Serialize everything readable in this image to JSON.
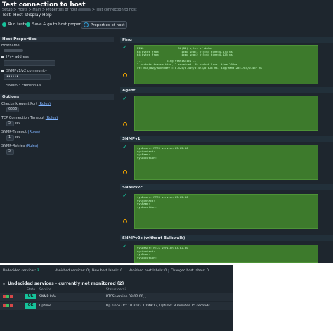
{
  "window": {
    "title": "Test connection to host",
    "breadcrumb": [
      "Setup",
      "Hosts",
      "Main",
      "Properties of host",
      "Test connection to host"
    ]
  },
  "menu": [
    "Test",
    "Host",
    "Display",
    "Help"
  ],
  "toolbar": {
    "run": "Run tests",
    "save": "Save & go to host properties",
    "props": "Properties of host"
  },
  "sidebar": {
    "host_properties": "Host Properties",
    "hostname": "Hostname",
    "ipv4": "IPv4 address",
    "snmp_community": "SNMPv1/v2 community",
    "snmp_community_value": "••••••",
    "snmpv3": "SNMPv3 credentials",
    "options": "Options",
    "agent_port": "Checkmk Agent Port",
    "agent_port_rules": "(Rules)",
    "agent_port_value": "6556",
    "tcp_timeout": "TCP Connection Timeout",
    "tcp_timeout_rules": "(Rules)",
    "tcp_timeout_value": "5",
    "tcp_timeout_unit": "sec",
    "snmp_timeout": "SNMP-Timeout",
    "snmp_timeout_rules": "(Rules)",
    "snmp_timeout_value": "1",
    "snmp_timeout_unit": "sec",
    "snmp_retries": "SNMP-Retries",
    "snmp_retries_rules": "(Rules)",
    "snmp_retries_value": "5"
  },
  "panels": {
    "ping": {
      "title": "Ping",
      "output": "PING                     56(84) bytes of data.\n64 bytes from              icmp_seq=1 ttl=64 time=0.473 ms\n64 bytes from              icmp_seq=2 ttl=64 time=0.425 ms\n\n---               ping statistics ---\n2 packets transmitted, 2 received, 0% packet loss, time 205ms\nrtt min/avg/max/mdev = 0.425/0.449/0.473/0.024 ms, ipg/ewma 205.755/0.467 ms"
    },
    "agent": {
      "title": "Agent"
    },
    "snmpv1": {
      "title": "SNMPv1",
      "output": "sysDescr: RTCS version 03.02.00\nsysContact:\nsysName:\nsysLocation:"
    },
    "snmpv2c": {
      "title": "SNMPv2c",
      "output": "sysDescr: RTCS version 03.02.00\nsysContact:\nsysName:\nsysLocation:"
    },
    "snmpv2c_nobulk": {
      "title": "SNMPv2c (without Bulkwalk)",
      "output": "sysDescr: RTCS version 03.02.00\nsysContact:\nsysName:\nsysLocation:"
    }
  },
  "services": {
    "summary": [
      {
        "label": "Undecided services:",
        "value": "3"
      },
      {
        "label": "Vanished services:",
        "value": "0"
      },
      {
        "label": "New host labels:",
        "value": "0"
      },
      {
        "label": "Vanished host labels:",
        "value": "0"
      },
      {
        "label": "Changed host labels:",
        "value": "0"
      }
    ],
    "section_title": "Undecided services - currently not monitored (2)",
    "columns": {
      "state": "State",
      "service": "Service",
      "status": "Status detail"
    },
    "rows": [
      {
        "state": "OK",
        "service": "SNMP Info",
        "detail": "RTCS version 03.02.00, , ,"
      },
      {
        "state": "OK",
        "service": "Uptime",
        "detail": "Up since Oct 10 2022 10:49:17, Uptime: 8 minutes 35 seconds"
      }
    ]
  },
  "colors": {
    "ok": "#16c39b",
    "terminal_bg": "#3d7a2c",
    "app_bg": "#1e262e"
  }
}
